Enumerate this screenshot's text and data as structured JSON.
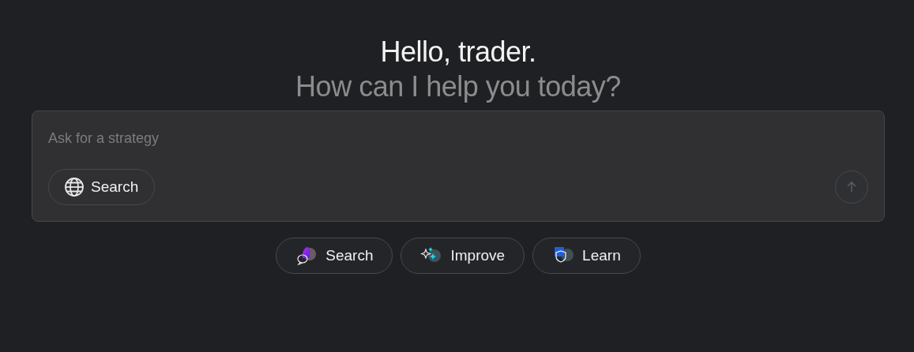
{
  "greeting": {
    "title": "Hello, trader.",
    "subtitle": "How can I help you today?"
  },
  "composer": {
    "placeholder": "Ask for a strategy",
    "tool_button": {
      "label": "Search"
    },
    "send_button": {
      "disabled": true
    }
  },
  "suggestions": [
    {
      "kind": "search",
      "label": "Search"
    },
    {
      "kind": "improve",
      "label": "Improve"
    },
    {
      "kind": "learn",
      "label": "Learn"
    }
  ]
}
